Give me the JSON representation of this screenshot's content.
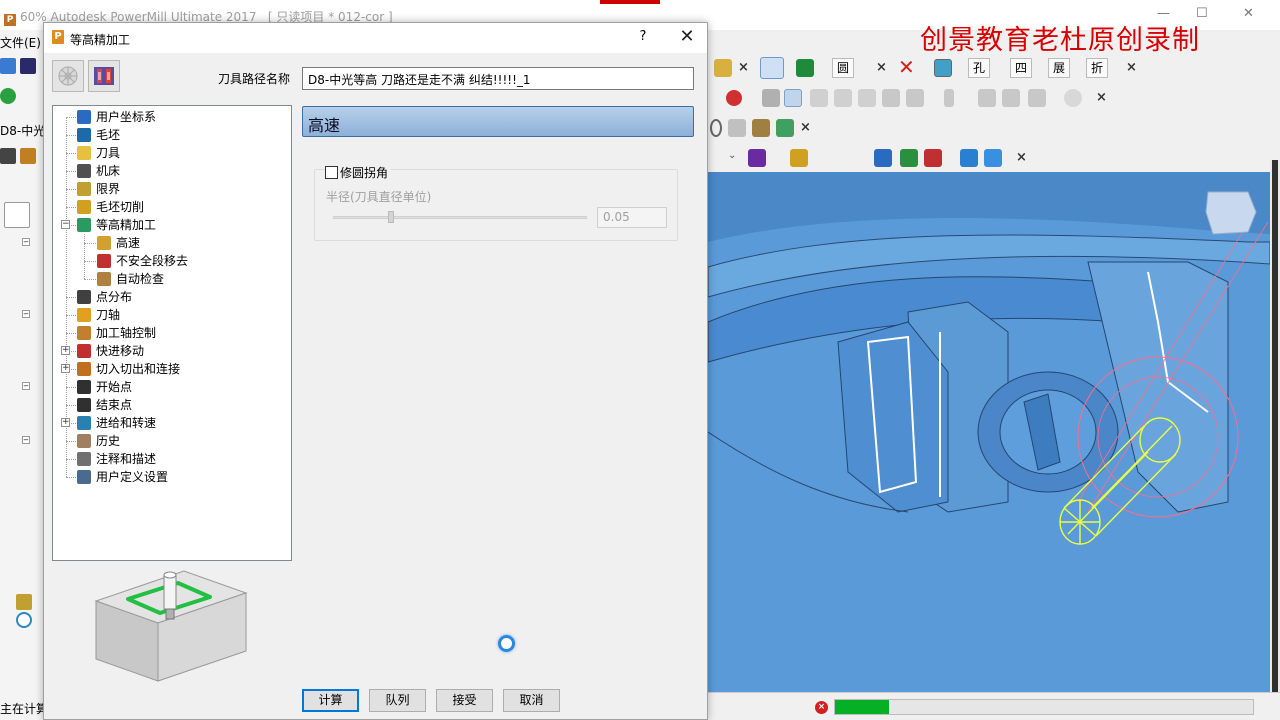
{
  "app": {
    "title": "60% Autodesk PowerMill Ultimate 2017",
    "project_label": "[ 只读项目 * 012-cor ]",
    "menu_file": "文件(E)",
    "side_label": "D8-中光",
    "status_text": "主在计算",
    "watermark": "创景教育老杜原创录制",
    "minimize": "—",
    "maximize": "☐",
    "close": "✕"
  },
  "toolbar": {
    "row1": {
      "circle_label": "圆",
      "hole_label": "孔",
      "four_label": "四",
      "expand_label": "展",
      "fold_label": "折"
    },
    "close_glyph": "×",
    "dropdown_glyph": "⌄"
  },
  "statusbar": {
    "stop_glyph": "×",
    "progress": 0.13
  },
  "dialog": {
    "title": "等高精加工",
    "title_icon": "P",
    "help": "?",
    "close": "✕",
    "toolpath_name_label": "刀具路径名称",
    "toolpath_name_value": "D8-中光等高  刀路还是走不满  纠结!!!!!_1",
    "tree": [
      {
        "label": "用户坐标系",
        "icon": "ucs-icon"
      },
      {
        "label": "毛坯",
        "icon": "block-icon"
      },
      {
        "label": "刀具",
        "icon": "tool-icon"
      },
      {
        "label": "机床",
        "icon": "machine-icon"
      },
      {
        "label": "限界",
        "icon": "boundary-icon"
      },
      {
        "label": "毛坯切削",
        "icon": "stock-cut-icon"
      },
      {
        "label": "等高精加工",
        "icon": "constant-z-icon"
      },
      {
        "label": "高速",
        "icon": "high-speed-icon"
      },
      {
        "label": "不安全段移去",
        "icon": "unsafe-remove-icon"
      },
      {
        "label": "自动检查",
        "icon": "auto-verify-icon"
      },
      {
        "label": "点分布",
        "icon": "point-distribution-icon"
      },
      {
        "label": "刀轴",
        "icon": "tool-axis-icon"
      },
      {
        "label": "加工轴控制",
        "icon": "axis-control-icon"
      },
      {
        "label": "快进移动",
        "icon": "rapid-move-icon"
      },
      {
        "label": "切入切出和连接",
        "icon": "leads-links-icon"
      },
      {
        "label": "开始点",
        "icon": "start-point-icon"
      },
      {
        "label": "结束点",
        "icon": "end-point-icon"
      },
      {
        "label": "进给和转速",
        "icon": "feeds-speeds-icon"
      },
      {
        "label": "历史",
        "icon": "history-icon"
      },
      {
        "label": "注释和描述",
        "icon": "notes-icon"
      },
      {
        "label": "用户定义设置",
        "icon": "user-settings-icon"
      }
    ],
    "expander_plus": "+",
    "expander_minus": "−",
    "page_title": "高速",
    "fillet_corners_label": "修圆拐角",
    "fillet_corners_checked": false,
    "radius_label": "半径(刀具直径单位)",
    "radius_value": "0.05",
    "radius_slider_level": 0.23,
    "buttons": {
      "calculate": "计算",
      "queue": "队列",
      "accept": "接受",
      "cancel": "取消"
    }
  },
  "colors": {
    "viewport_blue": "#5a9ad8",
    "watermark_red": "#d80000",
    "progress_green": "#06b025",
    "header_blue": "#8cb0d8",
    "spinner_blue": "#2a88e0"
  }
}
